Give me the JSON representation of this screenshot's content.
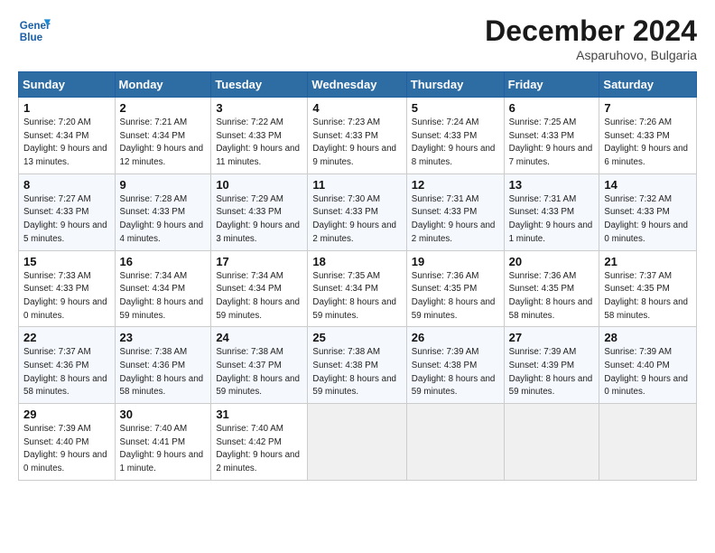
{
  "header": {
    "logo_line1": "General",
    "logo_line2": "Blue",
    "month": "December 2024",
    "location": "Asparuhovo, Bulgaria"
  },
  "weekdays": [
    "Sunday",
    "Monday",
    "Tuesday",
    "Wednesday",
    "Thursday",
    "Friday",
    "Saturday"
  ],
  "weeks": [
    [
      {
        "day": "1",
        "sunrise": "Sunrise: 7:20 AM",
        "sunset": "Sunset: 4:34 PM",
        "daylight": "Daylight: 9 hours and 13 minutes."
      },
      {
        "day": "2",
        "sunrise": "Sunrise: 7:21 AM",
        "sunset": "Sunset: 4:34 PM",
        "daylight": "Daylight: 9 hours and 12 minutes."
      },
      {
        "day": "3",
        "sunrise": "Sunrise: 7:22 AM",
        "sunset": "Sunset: 4:33 PM",
        "daylight": "Daylight: 9 hours and 11 minutes."
      },
      {
        "day": "4",
        "sunrise": "Sunrise: 7:23 AM",
        "sunset": "Sunset: 4:33 PM",
        "daylight": "Daylight: 9 hours and 9 minutes."
      },
      {
        "day": "5",
        "sunrise": "Sunrise: 7:24 AM",
        "sunset": "Sunset: 4:33 PM",
        "daylight": "Daylight: 9 hours and 8 minutes."
      },
      {
        "day": "6",
        "sunrise": "Sunrise: 7:25 AM",
        "sunset": "Sunset: 4:33 PM",
        "daylight": "Daylight: 9 hours and 7 minutes."
      },
      {
        "day": "7",
        "sunrise": "Sunrise: 7:26 AM",
        "sunset": "Sunset: 4:33 PM",
        "daylight": "Daylight: 9 hours and 6 minutes."
      }
    ],
    [
      {
        "day": "8",
        "sunrise": "Sunrise: 7:27 AM",
        "sunset": "Sunset: 4:33 PM",
        "daylight": "Daylight: 9 hours and 5 minutes."
      },
      {
        "day": "9",
        "sunrise": "Sunrise: 7:28 AM",
        "sunset": "Sunset: 4:33 PM",
        "daylight": "Daylight: 9 hours and 4 minutes."
      },
      {
        "day": "10",
        "sunrise": "Sunrise: 7:29 AM",
        "sunset": "Sunset: 4:33 PM",
        "daylight": "Daylight: 9 hours and 3 minutes."
      },
      {
        "day": "11",
        "sunrise": "Sunrise: 7:30 AM",
        "sunset": "Sunset: 4:33 PM",
        "daylight": "Daylight: 9 hours and 2 minutes."
      },
      {
        "day": "12",
        "sunrise": "Sunrise: 7:31 AM",
        "sunset": "Sunset: 4:33 PM",
        "daylight": "Daylight: 9 hours and 2 minutes."
      },
      {
        "day": "13",
        "sunrise": "Sunrise: 7:31 AM",
        "sunset": "Sunset: 4:33 PM",
        "daylight": "Daylight: 9 hours and 1 minute."
      },
      {
        "day": "14",
        "sunrise": "Sunrise: 7:32 AM",
        "sunset": "Sunset: 4:33 PM",
        "daylight": "Daylight: 9 hours and 0 minutes."
      }
    ],
    [
      {
        "day": "15",
        "sunrise": "Sunrise: 7:33 AM",
        "sunset": "Sunset: 4:33 PM",
        "daylight": "Daylight: 9 hours and 0 minutes."
      },
      {
        "day": "16",
        "sunrise": "Sunrise: 7:34 AM",
        "sunset": "Sunset: 4:34 PM",
        "daylight": "Daylight: 8 hours and 59 minutes."
      },
      {
        "day": "17",
        "sunrise": "Sunrise: 7:34 AM",
        "sunset": "Sunset: 4:34 PM",
        "daylight": "Daylight: 8 hours and 59 minutes."
      },
      {
        "day": "18",
        "sunrise": "Sunrise: 7:35 AM",
        "sunset": "Sunset: 4:34 PM",
        "daylight": "Daylight: 8 hours and 59 minutes."
      },
      {
        "day": "19",
        "sunrise": "Sunrise: 7:36 AM",
        "sunset": "Sunset: 4:35 PM",
        "daylight": "Daylight: 8 hours and 59 minutes."
      },
      {
        "day": "20",
        "sunrise": "Sunrise: 7:36 AM",
        "sunset": "Sunset: 4:35 PM",
        "daylight": "Daylight: 8 hours and 58 minutes."
      },
      {
        "day": "21",
        "sunrise": "Sunrise: 7:37 AM",
        "sunset": "Sunset: 4:35 PM",
        "daylight": "Daylight: 8 hours and 58 minutes."
      }
    ],
    [
      {
        "day": "22",
        "sunrise": "Sunrise: 7:37 AM",
        "sunset": "Sunset: 4:36 PM",
        "daylight": "Daylight: 8 hours and 58 minutes."
      },
      {
        "day": "23",
        "sunrise": "Sunrise: 7:38 AM",
        "sunset": "Sunset: 4:36 PM",
        "daylight": "Daylight: 8 hours and 58 minutes."
      },
      {
        "day": "24",
        "sunrise": "Sunrise: 7:38 AM",
        "sunset": "Sunset: 4:37 PM",
        "daylight": "Daylight: 8 hours and 59 minutes."
      },
      {
        "day": "25",
        "sunrise": "Sunrise: 7:38 AM",
        "sunset": "Sunset: 4:38 PM",
        "daylight": "Daylight: 8 hours and 59 minutes."
      },
      {
        "day": "26",
        "sunrise": "Sunrise: 7:39 AM",
        "sunset": "Sunset: 4:38 PM",
        "daylight": "Daylight: 8 hours and 59 minutes."
      },
      {
        "day": "27",
        "sunrise": "Sunrise: 7:39 AM",
        "sunset": "Sunset: 4:39 PM",
        "daylight": "Daylight: 8 hours and 59 minutes."
      },
      {
        "day": "28",
        "sunrise": "Sunrise: 7:39 AM",
        "sunset": "Sunset: 4:40 PM",
        "daylight": "Daylight: 9 hours and 0 minutes."
      }
    ],
    [
      {
        "day": "29",
        "sunrise": "Sunrise: 7:39 AM",
        "sunset": "Sunset: 4:40 PM",
        "daylight": "Daylight: 9 hours and 0 minutes."
      },
      {
        "day": "30",
        "sunrise": "Sunrise: 7:40 AM",
        "sunset": "Sunset: 4:41 PM",
        "daylight": "Daylight: 9 hours and 1 minute."
      },
      {
        "day": "31",
        "sunrise": "Sunrise: 7:40 AM",
        "sunset": "Sunset: 4:42 PM",
        "daylight": "Daylight: 9 hours and 2 minutes."
      },
      null,
      null,
      null,
      null
    ]
  ]
}
